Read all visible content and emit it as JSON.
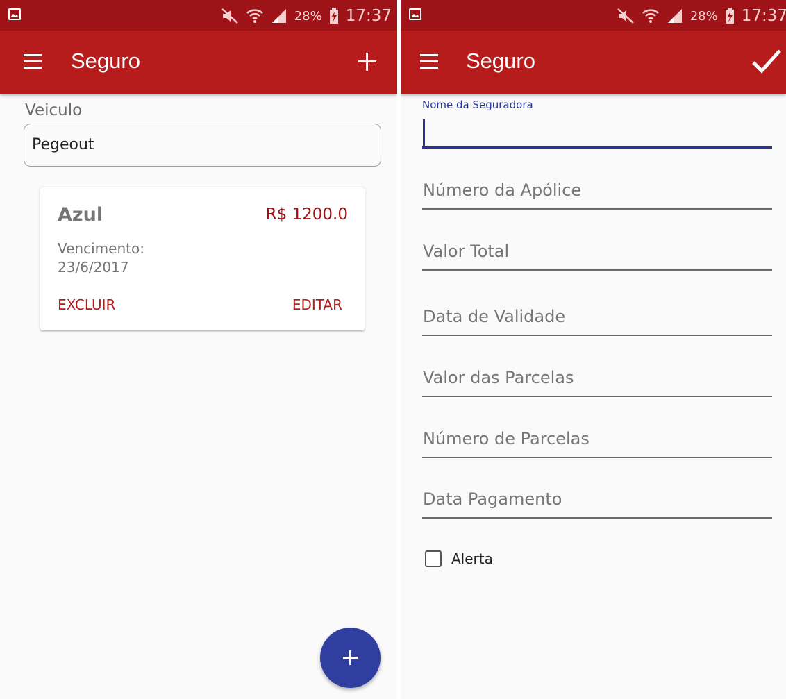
{
  "status_bar": {
    "battery_percent": "28%",
    "time": "17:37",
    "icons": [
      "gallery-icon",
      "mute-icon",
      "wifi-icon",
      "signal-icon",
      "battery-charging-icon"
    ]
  },
  "left": {
    "appbar": {
      "title": "Seguro",
      "menu_icon": "menu-icon",
      "action_icon": "add-icon"
    },
    "vehicle": {
      "label": "Veiculo",
      "value": "Pegeout"
    },
    "card": {
      "title": "Azul",
      "price": "R$ 1200.0",
      "due_label": "Vencimento:",
      "due_date": "23/6/2017",
      "delete_label": "EXCLUIR",
      "edit_label": "EDITAR"
    },
    "fab_icon": "add-icon"
  },
  "right": {
    "appbar": {
      "title": "Seguro",
      "menu_icon": "menu-icon",
      "action_icon": "check-icon"
    },
    "active_field": {
      "label": "Nome da Seguradora",
      "value": ""
    },
    "fields": [
      {
        "placeholder": "Número da Apólice"
      },
      {
        "placeholder": "Valor Total"
      },
      {
        "placeholder": "Data de Validade"
      },
      {
        "placeholder": "Valor das Parcelas"
      },
      {
        "placeholder": "Número de Parcelas"
      },
      {
        "placeholder": "Data Pagamento"
      }
    ],
    "checkbox": {
      "label": "Alerta",
      "checked": false
    }
  },
  "colors": {
    "statusbar": "#9f1418",
    "appbar": "#b71c1c",
    "accent": "#303f9f",
    "focused_field": "#283593",
    "price": "#a50f12"
  }
}
